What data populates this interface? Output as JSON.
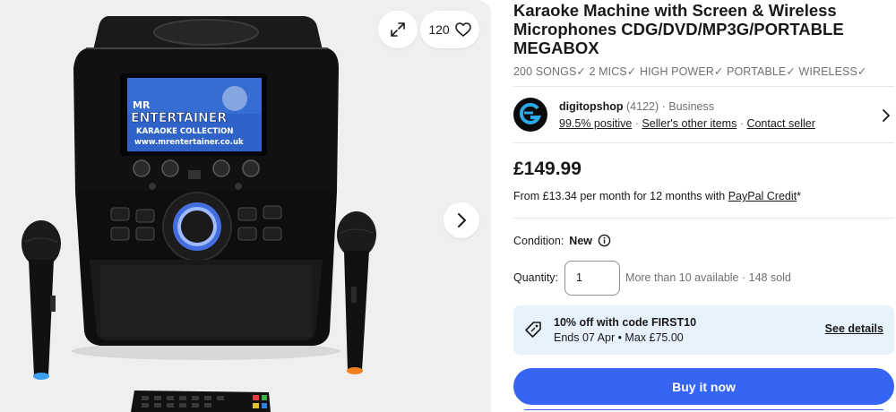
{
  "gallery": {
    "watch_count": "120",
    "screen_text": {
      "brand_top": "MR",
      "brand_main": "ENTERTAINER",
      "collection": "KARAOKE COLLECTION",
      "url": "www.mrentertainer.co.uk"
    }
  },
  "item": {
    "title": "Karaoke Machine with Screen & Wireless Microphones CDG/DVD/MP3G/PORTABLE MEGABOX",
    "subtitle": "200 SONGS✓ 2 MICS✓ HIGH POWER✓ PORTABLE✓ WIRELESS✓"
  },
  "seller": {
    "name": "digitopshop",
    "feedback_count": "(4122)",
    "separator": " · ",
    "type": "Business",
    "positive": "99.5% positive",
    "other_items": "Seller's other items",
    "contact": "Contact seller",
    "dot": " · "
  },
  "pricing": {
    "price": "£149.99",
    "credit_prefix": "From £13.34 per month for 12 months with ",
    "credit_link": "PayPal Credit",
    "credit_suffix": "*"
  },
  "condition": {
    "label": "Condition:",
    "value": "New"
  },
  "quantity": {
    "label": "Quantity:",
    "value": "1",
    "availability": "More than 10 available · 148 sold"
  },
  "coupon": {
    "title": "10% off with code FIRST10",
    "details": "Ends 07 Apr • Max £75.00",
    "link": "See details"
  },
  "actions": {
    "buy_now": "Buy it now"
  },
  "colors": {
    "accent": "#3665f3",
    "coupon_bg": "#e6f1fb",
    "gallery_bg": "#efefef"
  },
  "icons": {
    "expand": "expand-icon",
    "watch": "heart-icon",
    "next": "chevron-right-icon",
    "info": "info-icon",
    "coupon": "tag-icon",
    "seller_chevron": "chevron-right-icon"
  }
}
